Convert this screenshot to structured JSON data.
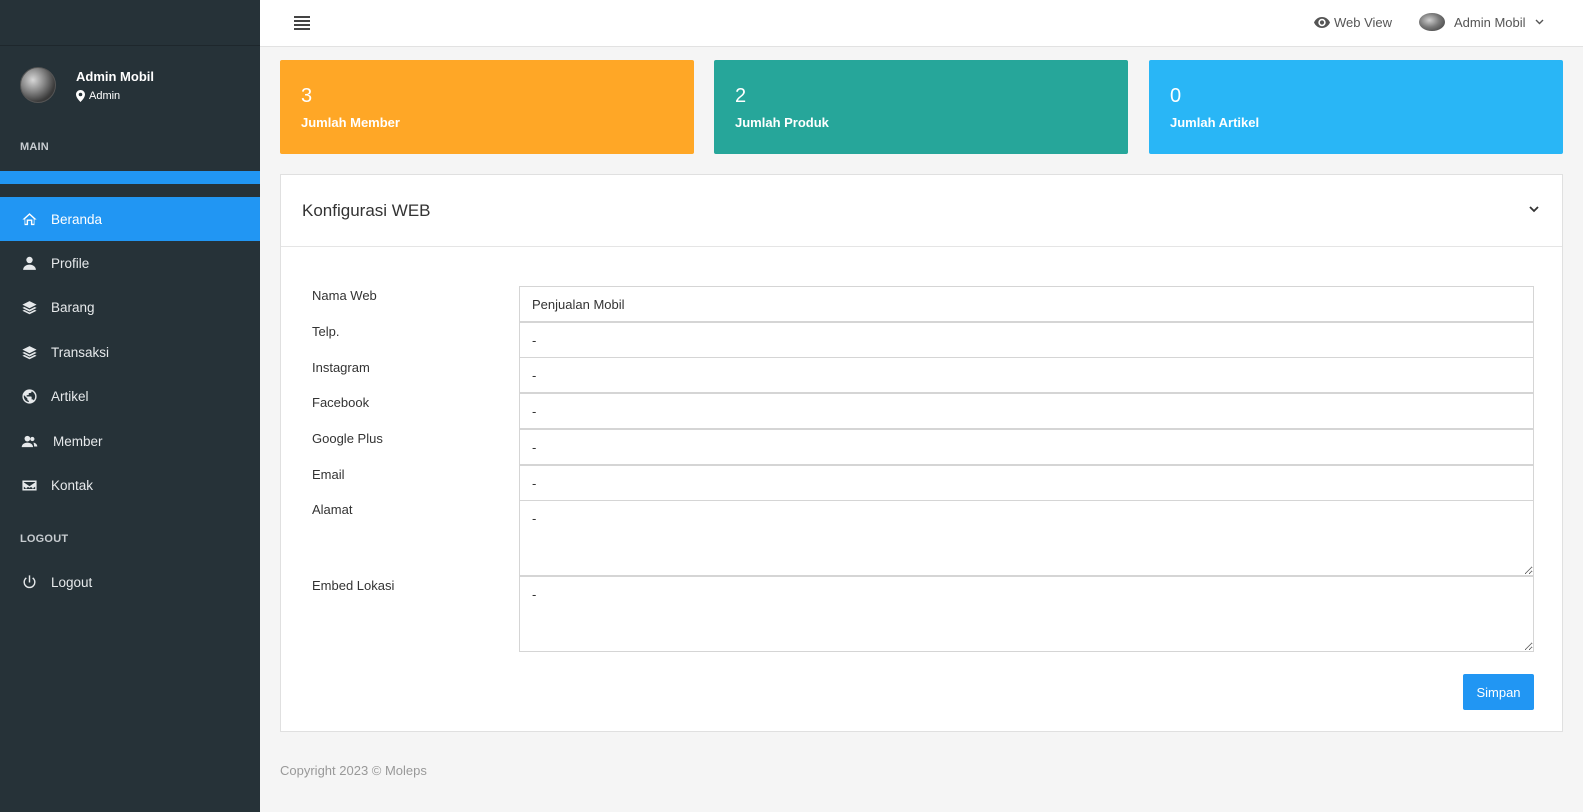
{
  "sidebar": {
    "user": {
      "name": "Admin Mobil",
      "role": "Admin"
    },
    "heading_main": "MAIN",
    "heading_logout": "LOGOUT",
    "items": [
      {
        "label": "Beranda",
        "icon": "home-icon",
        "active": true
      },
      {
        "label": "Profile",
        "icon": "user-icon"
      },
      {
        "label": "Barang",
        "icon": "layers-icon"
      },
      {
        "label": "Transaksi",
        "icon": "layers-icon"
      },
      {
        "label": "Artikel",
        "icon": "globe-icon"
      },
      {
        "label": "Member",
        "icon": "users-icon"
      },
      {
        "label": "Kontak",
        "icon": "envelope-icon"
      }
    ],
    "logout_label": "Logout"
  },
  "header": {
    "web_view": "Web View",
    "user_name": "Admin Mobil"
  },
  "stats": [
    {
      "value": "3",
      "label": "Jumlah Member",
      "color": "#ffa726"
    },
    {
      "value": "2",
      "label": "Jumlah Produk",
      "color": "#26a69a"
    },
    {
      "value": "0",
      "label": "Jumlah Artikel",
      "color": "#29b6f6"
    }
  ],
  "panel": {
    "title": "Konfigurasi WEB",
    "fields": {
      "nama_web": {
        "label": "Nama Web",
        "value": "Penjualan Mobil"
      },
      "telp": {
        "label": "Telp.",
        "value": "-"
      },
      "instagram": {
        "label": "Instagram",
        "value": "-"
      },
      "facebook": {
        "label": "Facebook",
        "value": "-"
      },
      "google_plus": {
        "label": "Google Plus",
        "value": "-"
      },
      "email": {
        "label": "Email",
        "value": "-"
      },
      "alamat": {
        "label": "Alamat",
        "value": "-"
      },
      "embed_lokasi": {
        "label": "Embed Lokasi",
        "value": "-"
      }
    },
    "save_label": "Simpan"
  },
  "footer": {
    "text": "Copyright 2023 © Moleps"
  },
  "colors": {
    "sidebar_bg": "#263238",
    "accent": "#2196f3"
  }
}
